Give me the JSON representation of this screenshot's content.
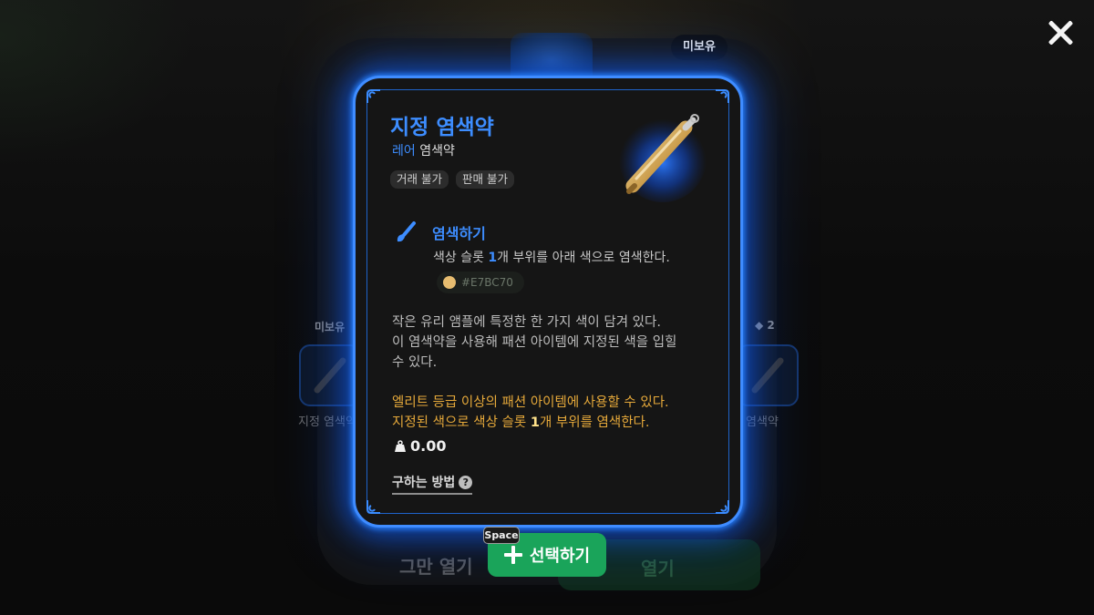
{
  "background": {
    "left_slot": {
      "status": "미보유",
      "name": "지정 염색약"
    },
    "right_slot": {
      "count": "2",
      "name": "지정 염색약"
    },
    "stop_label": "그만 열기",
    "open_label": "열기"
  },
  "ownership_badge": "미보유",
  "item": {
    "name": "지정 염색약",
    "rarity": "레어",
    "category": "염색약",
    "tags": [
      "거래 불가",
      "판매 불가"
    ],
    "effect": {
      "title": "염색하기",
      "desc_before": "색상 슬롯 ",
      "desc_num": "1",
      "desc_after": "개 부위를 아래 색으로 염색한다.",
      "color_hex": "#E7BC70",
      "swatch_color": "#E7BC70"
    },
    "description": [
      "작은 유리 앰플에 특정한 한 가지 색이 담겨 있다.",
      "이 염색약을 사용해 패션 아이템에 지정된 색을 입힐",
      "수 있다."
    ],
    "usage_line1": "엘리트 등급 이상의 패션 아이템에 사용할 수 있다.",
    "usage_line2_before": "지정된 색으로 색상 슬롯 ",
    "usage_line2_num": "1",
    "usage_line2_after": "개 부위를 염색한다.",
    "price": "0.00",
    "how_to_obtain": "구하는 방법",
    "help_glyph": "?"
  },
  "select_button": {
    "hotkey": "Space",
    "label": "선택하기"
  },
  "colors": {
    "accent_blue": "#3d8dff",
    "card_border": "#3f8cff",
    "select_green": "#1aa45a",
    "usage_orange": "#e6a93a"
  }
}
